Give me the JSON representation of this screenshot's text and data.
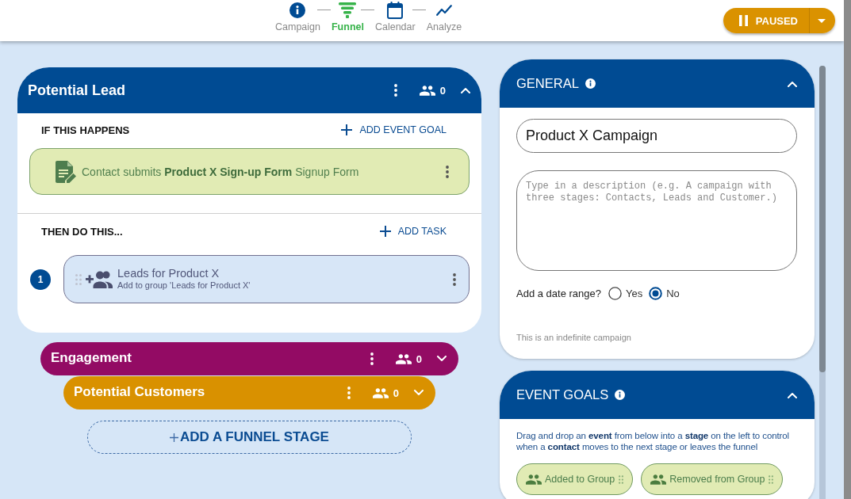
{
  "nav_steps": [
    {
      "label": "Campaign",
      "selected": false
    },
    {
      "label": "Funnel",
      "selected": true
    },
    {
      "label": "Calendar",
      "selected": false
    },
    {
      "label": "Analyze",
      "selected": false
    }
  ],
  "status_button": {
    "label": "PAUSED"
  },
  "stages": [
    {
      "title": "Potential Lead",
      "color": "#004b93",
      "count": "0",
      "expanded": true,
      "trigger_heading": "IF THIS HAPPENS",
      "add_goal_label": "ADD EVENT GOAL",
      "event_goals": [
        {
          "text": "Contact submits **Product X Sign-up Form** Signup Form"
        }
      ],
      "action_heading": "THEN DO THIS...",
      "add_task_label": "ADD TASK",
      "tasks": [
        {
          "number": "1",
          "title": "Leads for Product X",
          "subtitle": "Add to group 'Leads for Product X'"
        }
      ]
    },
    {
      "title": "Engagement",
      "color": "#930b64",
      "count": "0",
      "expanded": false
    },
    {
      "title": "Potential Customers",
      "color": "#d99100",
      "count": "0",
      "expanded": false
    }
  ],
  "add_stage_label": "ADD A FUNNEL STAGE",
  "general_panel": {
    "title": "GENERAL",
    "expanded": true,
    "name_value": "Product X Campaign",
    "description_placeholder": "Type in a description (e.g. A campaign with three stages: Contacts, Leads and Customer.)",
    "date_range_label": "Add a date range?",
    "date_range_options": [
      {
        "label": "Yes",
        "selected": false
      },
      {
        "label": "No",
        "selected": true
      }
    ],
    "note": "This is an indefinite campaign"
  },
  "event_goals_panel": {
    "title": "EVENT GOALS",
    "expanded": true,
    "description": "Drag and drop an **event** from below into a **stage** on the left to control when a **contact** moves to the next stage or leaves the funnel",
    "events": [
      {
        "label": "Added to Group"
      },
      {
        "label": "Removed from Group"
      }
    ]
  }
}
